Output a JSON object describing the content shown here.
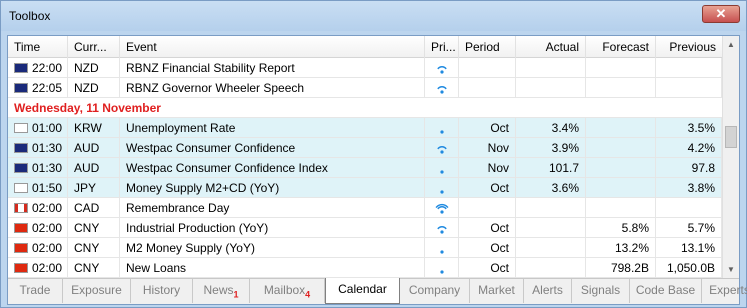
{
  "window": {
    "title": "Toolbox",
    "close_glyph": "✕"
  },
  "columns": {
    "time": "Time",
    "currency": "Curr...",
    "event": "Event",
    "priority": "Pri...",
    "period": "Period",
    "actual": "Actual",
    "forecast": "Forecast",
    "previous": "Previous"
  },
  "rows": [
    {
      "time": "22:00",
      "currency": "NZD",
      "event": "RBNZ Financial Stability Report",
      "priority": "speech",
      "period": "",
      "actual": "",
      "forecast": "",
      "previous": "",
      "flag": "nz",
      "highlight": false
    },
    {
      "time": "22:05",
      "currency": "NZD",
      "event": "RBNZ Governor Wheeler Speech",
      "priority": "speech",
      "period": "",
      "actual": "",
      "forecast": "",
      "previous": "",
      "flag": "nz",
      "highlight": false
    },
    {
      "date": "Wednesday, 11 November"
    },
    {
      "time": "01:00",
      "currency": "KRW",
      "event": "Unemployment Rate",
      "priority": "low",
      "period": "Oct",
      "actual": "3.4%",
      "forecast": "",
      "previous": "3.5%",
      "flag": "kr",
      "highlight": true
    },
    {
      "time": "01:30",
      "currency": "AUD",
      "event": "Westpac Consumer Confidence",
      "priority": "medium",
      "period": "Nov",
      "actual": "3.9%",
      "forecast": "",
      "previous": "4.2%",
      "flag": "au",
      "highlight": true
    },
    {
      "time": "01:30",
      "currency": "AUD",
      "event": "Westpac Consumer Confidence Index",
      "priority": "low",
      "period": "Nov",
      "actual": "101.7",
      "forecast": "",
      "previous": "97.8",
      "flag": "au",
      "highlight": true
    },
    {
      "time": "01:50",
      "currency": "JPY",
      "event": "Money Supply M2+CD (YoY)",
      "priority": "low",
      "period": "Oct",
      "actual": "3.6%",
      "forecast": "",
      "previous": "3.8%",
      "flag": "jp",
      "highlight": true
    },
    {
      "time": "02:00",
      "currency": "CAD",
      "event": "Remembrance Day",
      "priority": "high",
      "period": "",
      "actual": "",
      "forecast": "",
      "previous": "",
      "flag": "ca",
      "highlight": false
    },
    {
      "time": "02:00",
      "currency": "CNY",
      "event": "Industrial Production (YoY)",
      "priority": "medium",
      "period": "Oct",
      "actual": "",
      "forecast": "5.8%",
      "previous": "5.7%",
      "flag": "cn",
      "highlight": false
    },
    {
      "time": "02:00",
      "currency": "CNY",
      "event": "M2 Money Supply (YoY)",
      "priority": "low",
      "period": "Oct",
      "actual": "",
      "forecast": "13.2%",
      "previous": "13.1%",
      "flag": "cn",
      "highlight": false
    },
    {
      "time": "02:00",
      "currency": "CNY",
      "event": "New Loans",
      "priority": "low",
      "period": "Oct",
      "actual": "",
      "forecast": "798.2B",
      "previous": "1,050.0B",
      "flag": "cn",
      "highlight": false
    }
  ],
  "tabs": [
    {
      "label": "Trade",
      "badge": ""
    },
    {
      "label": "Exposure",
      "badge": ""
    },
    {
      "label": "History",
      "badge": ""
    },
    {
      "label": "News",
      "badge": "1"
    },
    {
      "label": "Mailbox",
      "badge": "4"
    },
    {
      "label": "Calendar",
      "badge": "",
      "active": true
    },
    {
      "label": "Company",
      "badge": ""
    },
    {
      "label": "Market",
      "badge": ""
    },
    {
      "label": "Alerts",
      "badge": ""
    },
    {
      "label": "Signals",
      "badge": ""
    },
    {
      "label": "Code Base",
      "badge": ""
    },
    {
      "label": "Experts",
      "badge": ""
    }
  ],
  "colors": {
    "accent_date": "#e02020",
    "row_highlight": "#dff3f8",
    "priority_icon": "#1f8ae0"
  }
}
